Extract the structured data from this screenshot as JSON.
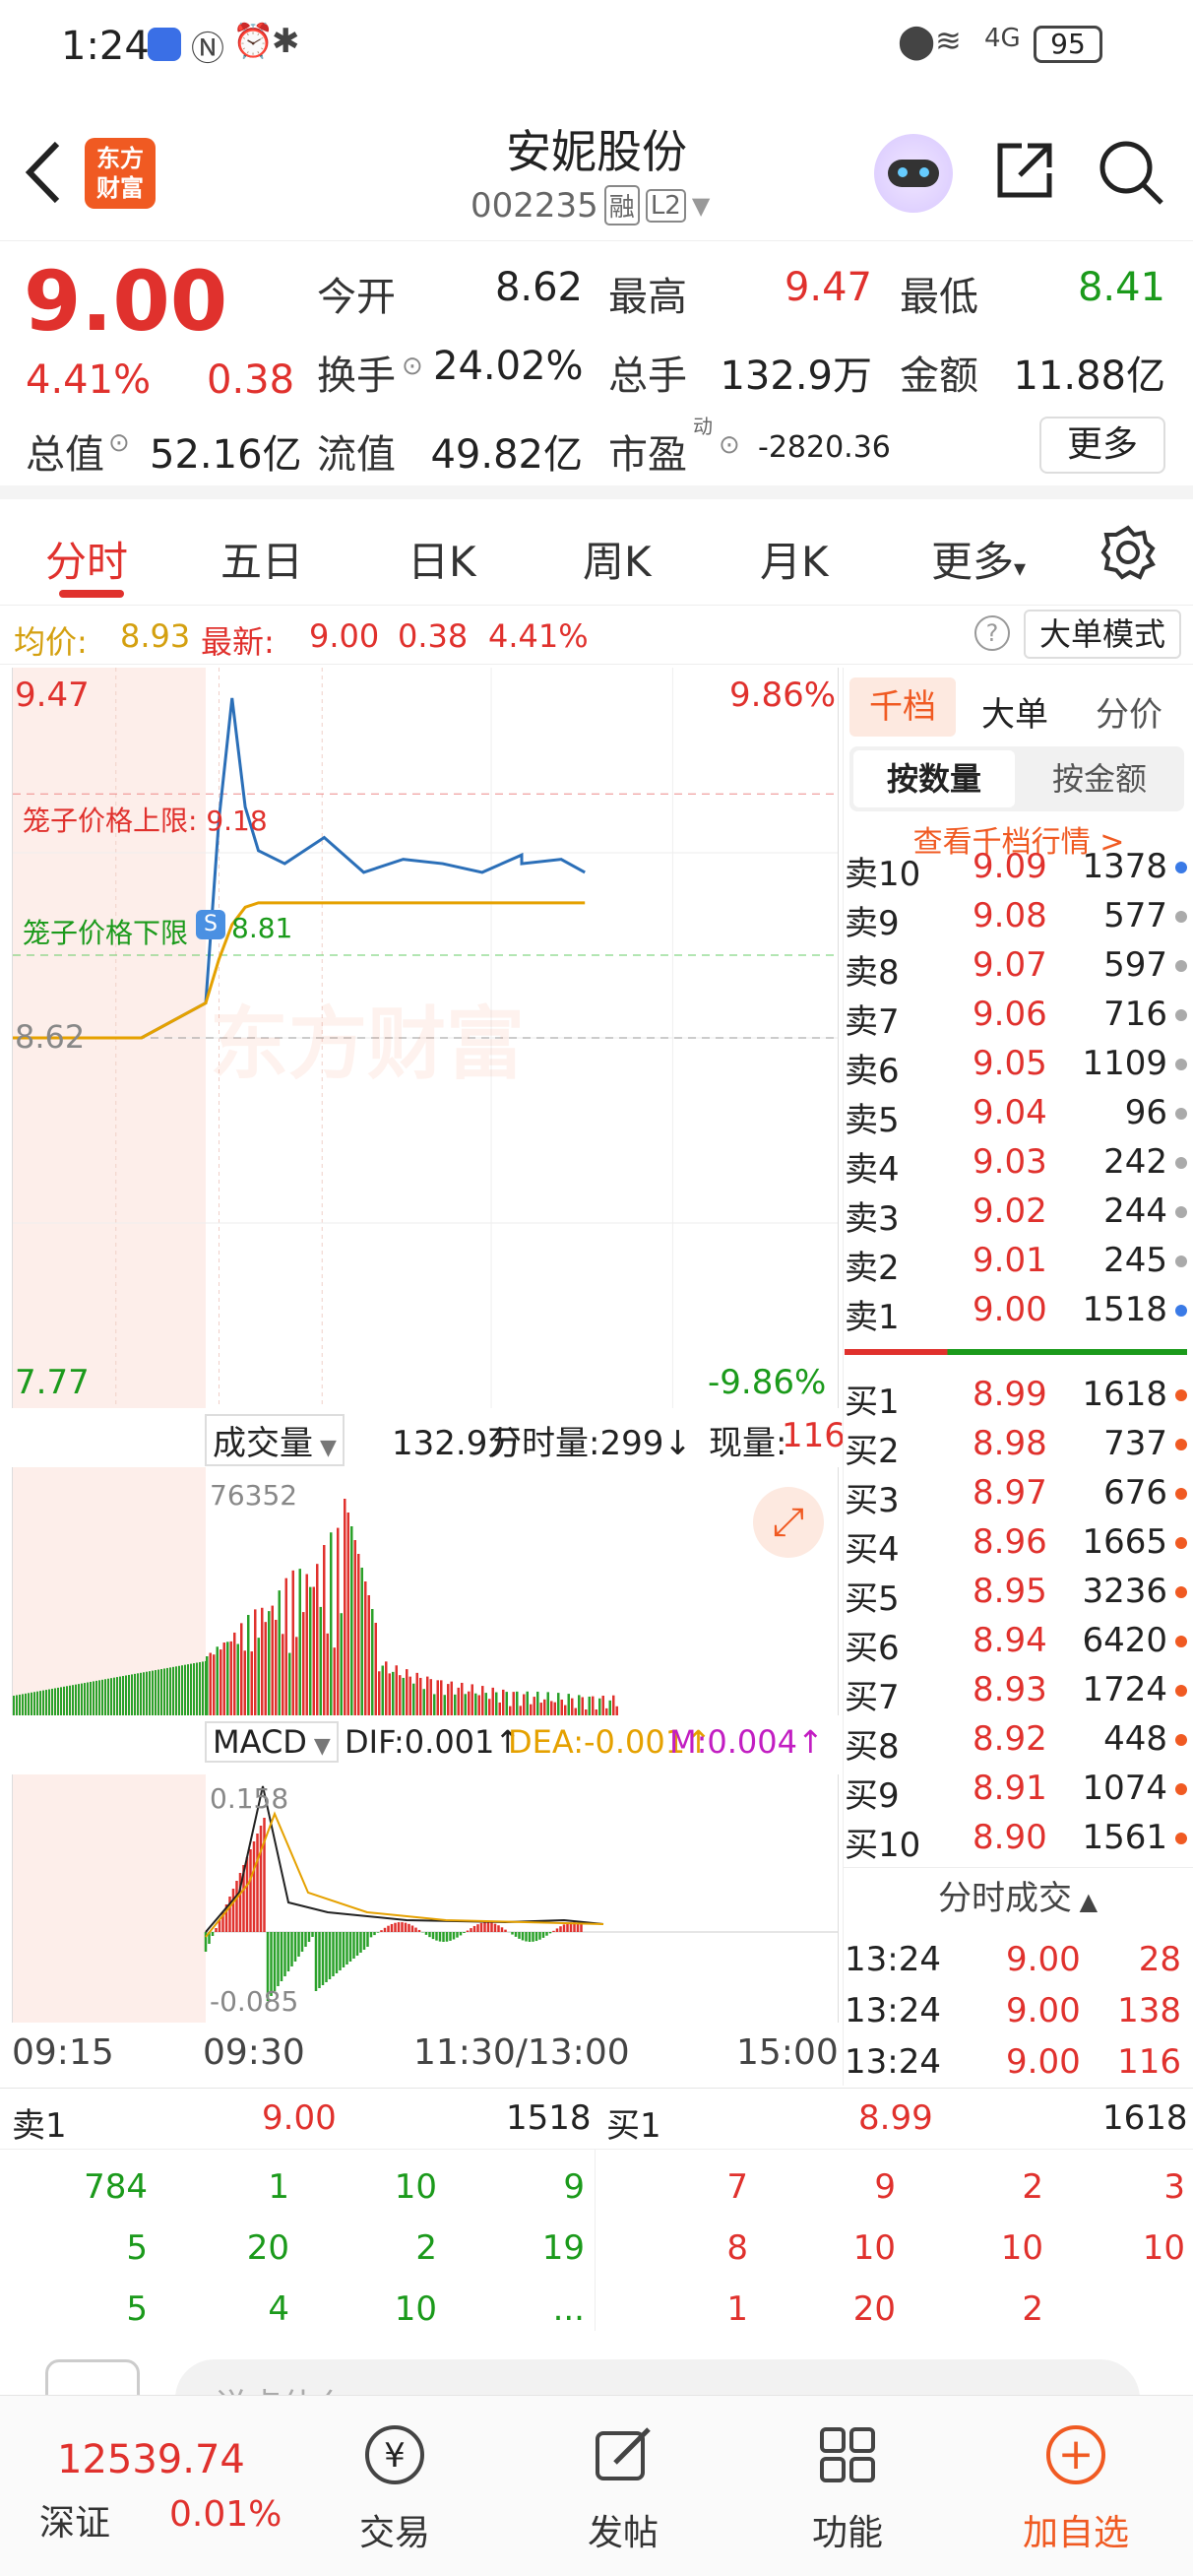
{
  "status": {
    "time": "1:24",
    "battery": "95",
    "network": "4G"
  },
  "header": {
    "stock_name": "安妮股份",
    "code": "002235",
    "tag_rong": "融",
    "tag_level": "L2",
    "logo_line1": "东方",
    "logo_line2": "财富"
  },
  "quote": {
    "price": "9.00",
    "change_pct": "4.41%",
    "change": "0.38",
    "open_label": "今开",
    "open": "8.62",
    "high_label": "最高",
    "high": "9.47",
    "low_label": "最低",
    "low": "8.41",
    "turnover_label": "换手",
    "turnover": "24.02%",
    "volume_label": "总手",
    "volume": "132.9万",
    "amount_label": "金额",
    "amount": "11.88亿",
    "mktcap_label": "总值",
    "mktcap": "52.16亿",
    "float_label": "流值",
    "float": "49.82亿",
    "pe_label": "市盈",
    "pe_sup": "动",
    "pe": "-2820.36",
    "more": "更多"
  },
  "tabs": {
    "t1": "分时",
    "t2": "五日",
    "t3": "日K",
    "t4": "周K",
    "t5": "月K",
    "t6": "更多"
  },
  "avg": {
    "avg_label": "均价:",
    "avg": "8.93",
    "last_label": "最新:",
    "last": "9.00",
    "chg": "0.38",
    "pct": "4.41%",
    "mode": "大单模式"
  },
  "chart": {
    "max": "9.47",
    "min": "7.77",
    "max_pct": "9.86%",
    "min_pct": "-9.86%",
    "base": "8.62",
    "cage_upper": "笼子价格上限: 9.18",
    "cage_lower": "笼子价格下限",
    "cage_lower_val": "8.81",
    "watermark": "东方财富",
    "vol_label": "成交量",
    "vol_total": "132.9万",
    "vol_min": "分时量:299↓",
    "vol_now_label": "现量:",
    "vol_now": "116",
    "vol_max": "76352",
    "macd_label": "MACD",
    "dif": "DIF:0.001↑",
    "dea": "DEA:-0.001↑",
    "m": "M:0.004↑",
    "macd_max": "0.158",
    "macd_min": "-0.085",
    "t0": "09:15",
    "t1": "09:30",
    "t2": "11:30/13:00",
    "t3": "15:00"
  },
  "chart_data": {
    "type": "line",
    "x": [
      "09:15",
      "09:25",
      "09:30",
      "09:35",
      "09:40",
      "09:45",
      "09:50",
      "10:00",
      "10:15",
      "10:30",
      "10:45",
      "11:00",
      "11:15",
      "11:30",
      "13:00",
      "13:15",
      "13:24"
    ],
    "series": [
      {
        "name": "价格",
        "values": [
          8.62,
          8.62,
          8.7,
          9.12,
          9.4,
          9.15,
          9.05,
          9.02,
          9.08,
          9.0,
          9.03,
          9.02,
          9.0,
          9.04,
          9.02,
          9.03,
          9.0
        ]
      },
      {
        "name": "均价",
        "values": [
          8.62,
          8.62,
          8.7,
          8.8,
          8.88,
          8.92,
          8.93,
          8.93,
          8.93,
          8.93,
          8.93,
          8.93,
          8.93,
          8.93,
          8.93,
          8.93,
          8.93
        ]
      }
    ],
    "ylim": [
      7.77,
      9.47
    ]
  },
  "orderbook": {
    "tab1": "千档",
    "tab2": "大单",
    "tab3": "分价",
    "sub1": "按数量",
    "sub2": "按金额",
    "view": "查看千档行情 >",
    "asks": [
      {
        "l": "卖10",
        "p": "9.09",
        "v": "1378"
      },
      {
        "l": "卖9",
        "p": "9.08",
        "v": "577"
      },
      {
        "l": "卖8",
        "p": "9.07",
        "v": "597"
      },
      {
        "l": "卖7",
        "p": "9.06",
        "v": "716"
      },
      {
        "l": "卖6",
        "p": "9.05",
        "v": "1109"
      },
      {
        "l": "卖5",
        "p": "9.04",
        "v": "96"
      },
      {
        "l": "卖4",
        "p": "9.03",
        "v": "242"
      },
      {
        "l": "卖3",
        "p": "9.02",
        "v": "244"
      },
      {
        "l": "卖2",
        "p": "9.01",
        "v": "245"
      },
      {
        "l": "卖1",
        "p": "9.00",
        "v": "1518"
      }
    ],
    "bids": [
      {
        "l": "买1",
        "p": "8.99",
        "v": "1618"
      },
      {
        "l": "买2",
        "p": "8.98",
        "v": "737"
      },
      {
        "l": "买3",
        "p": "8.97",
        "v": "676"
      },
      {
        "l": "买4",
        "p": "8.96",
        "v": "1665"
      },
      {
        "l": "买5",
        "p": "8.95",
        "v": "3236"
      },
      {
        "l": "买6",
        "p": "8.94",
        "v": "6420"
      },
      {
        "l": "买7",
        "p": "8.93",
        "v": "1724"
      },
      {
        "l": "买8",
        "p": "8.92",
        "v": "448"
      },
      {
        "l": "买9",
        "p": "8.91",
        "v": "1074"
      },
      {
        "l": "买10",
        "p": "8.90",
        "v": "1561"
      }
    ],
    "ticks_title": "分时成交",
    "ticks": [
      {
        "t": "13:24",
        "p": "9.00",
        "v": "28"
      },
      {
        "t": "13:24",
        "p": "9.00",
        "v": "138"
      },
      {
        "t": "13:24",
        "p": "9.00",
        "v": "116"
      }
    ]
  },
  "queue": {
    "ask_label": "卖1",
    "ask_price": "9.00",
    "ask_vol": "1518",
    "bid_label": "买1",
    "bid_price": "8.99",
    "bid_vol": "1618",
    "ask_rows": [
      [
        "784",
        "1",
        "10",
        "9"
      ],
      [
        "5",
        "20",
        "2",
        "19"
      ],
      [
        "5",
        "4",
        "10",
        "..."
      ]
    ],
    "bid_rows": [
      [
        "7",
        "9",
        "2",
        "3"
      ],
      [
        "8",
        "10",
        "10",
        "10"
      ],
      [
        "1",
        "20",
        "2",
        ""
      ]
    ]
  },
  "comment": {
    "placeholder": "说点什么..."
  },
  "bottom": {
    "index_val": "12539.74",
    "index_name": "深证",
    "index_pct": "0.01%",
    "trade": "交易",
    "post": "发帖",
    "func": "功能",
    "add": "加自选"
  }
}
